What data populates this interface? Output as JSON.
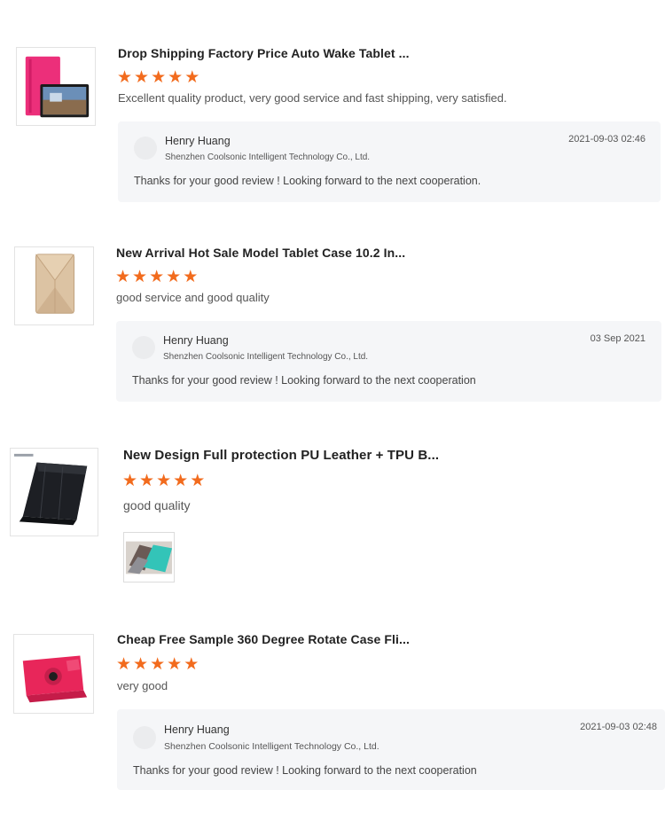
{
  "reviews": [
    {
      "product_title": "Drop Shipping Factory Price Auto Wake Tablet ...",
      "rating": 5,
      "comment": "Excellent quality product, very good service and fast shipping, very satisfied.",
      "reply": {
        "author": "Henry Huang",
        "company": "Shenzhen Coolsonic Intelligent Technology Co., Ltd.",
        "date": "2021-09-03 02:46",
        "text": "Thanks for your good review ! Looking forward to the next cooperation."
      }
    },
    {
      "product_title": "New Arrival Hot Sale Model Tablet Case 10.2 In...",
      "rating": 5,
      "comment": "good service and good quality",
      "reply": {
        "author": "Henry Huang",
        "company": "Shenzhen Coolsonic Intelligent Technology Co., Ltd.",
        "date": "03 Sep 2021",
        "text": "Thanks for your good review !  Looking forward to the next cooperation"
      }
    },
    {
      "product_title": "New Design Full protection PU Leather + TPU B...",
      "rating": 5,
      "comment": "good quality"
    },
    {
      "product_title": "Cheap Free Sample 360 Degree Rotate Case Fli...",
      "rating": 5,
      "comment": "very good",
      "reply": {
        "author": "Henry Huang",
        "company": "Shenzhen Coolsonic Intelligent Technology Co., Ltd.",
        "date": "2021-09-03 02:48",
        "text": "Thanks for your good review ! Looking forward to the next cooperation"
      }
    }
  ],
  "icons": {
    "star": "★",
    "star_color": "#f26b1d"
  }
}
